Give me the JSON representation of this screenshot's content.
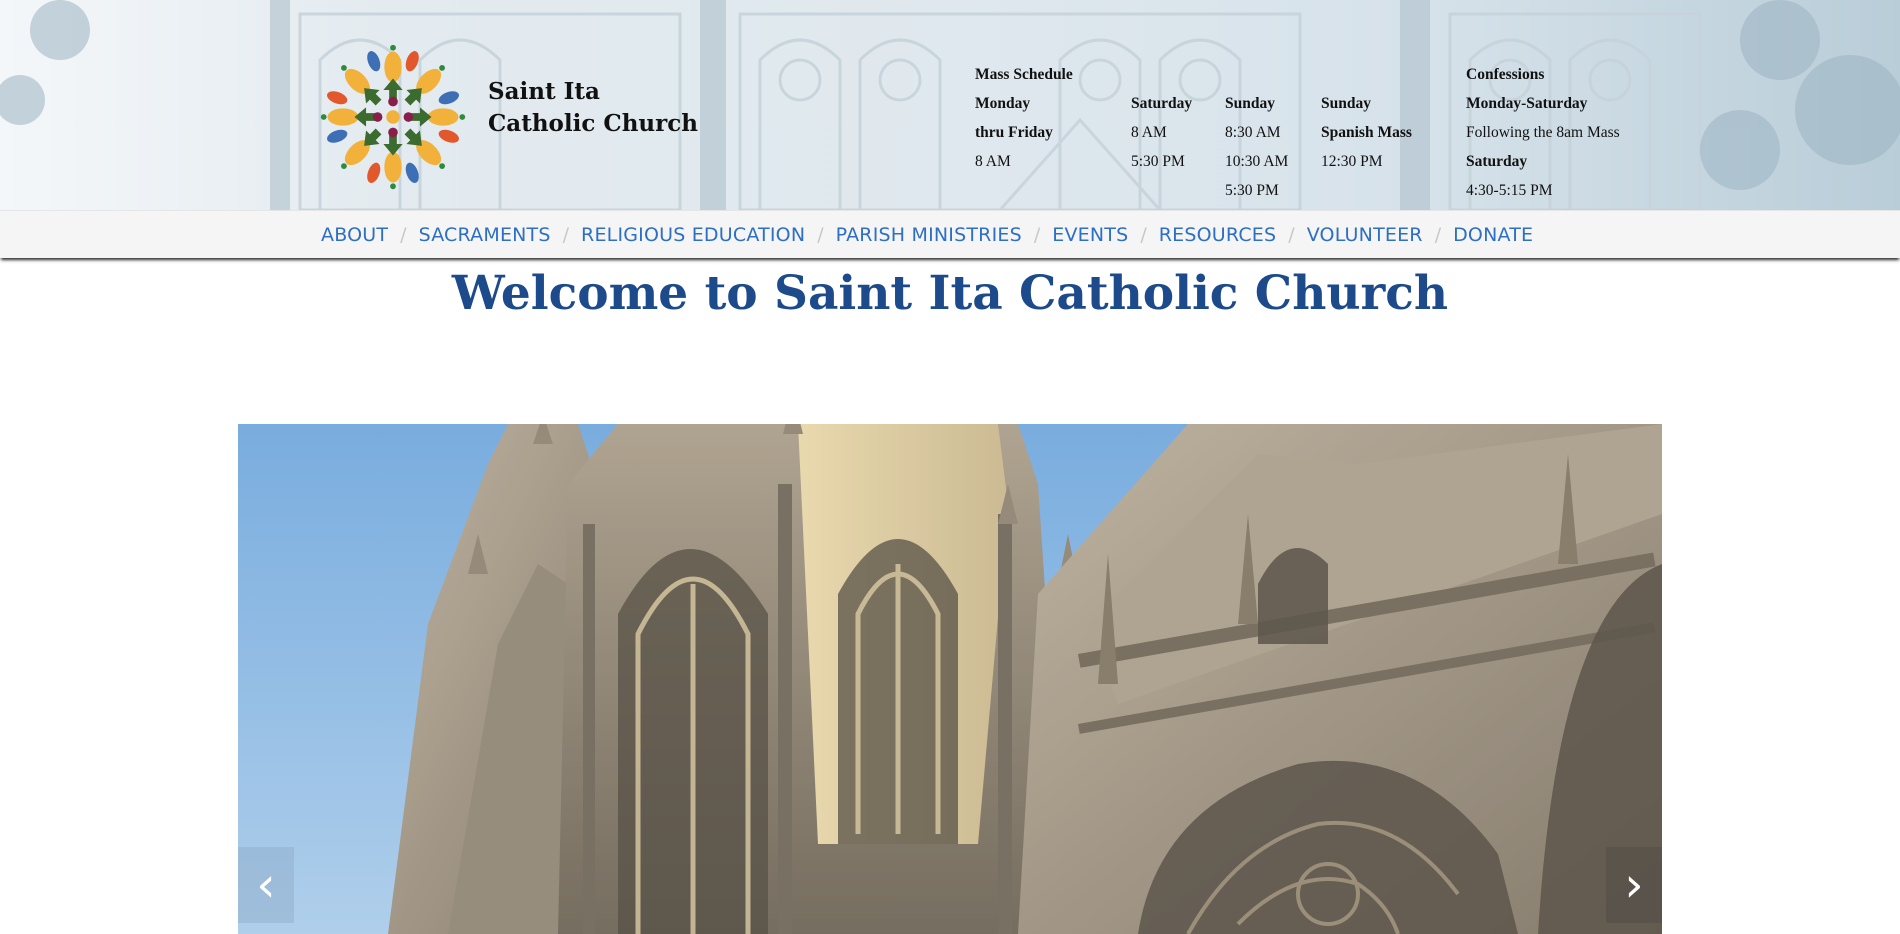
{
  "site": {
    "name_line1": "Saint Ita",
    "name_line2": "Catholic Church"
  },
  "mass_schedule": {
    "heading": "Mass Schedule",
    "weekday": {
      "line1": "Monday",
      "line2": "thru Friday",
      "time": "8 AM"
    },
    "saturday": {
      "day": "Saturday",
      "time1": "8 AM",
      "time2": "5:30 PM"
    },
    "sunday": {
      "day": "Sunday",
      "time1": "8:30 AM",
      "time2": "10:30 AM",
      "time3": "5:30 PM"
    },
    "sunday_spanish": {
      "day": "Sunday",
      "label": "Spanish Mass",
      "time": "12:30 PM"
    }
  },
  "confessions": {
    "heading": "Confessions",
    "days": "Monday-Saturday",
    "note": "Following the 8am Mass",
    "saturday": "Saturday",
    "saturday_time": "4:30-5:15 PM"
  },
  "nav": {
    "items": [
      {
        "label": "ABOUT"
      },
      {
        "label": "SACRAMENTS"
      },
      {
        "label": "RELIGIOUS EDUCATION"
      },
      {
        "label": "PARISH MINISTRIES"
      },
      {
        "label": "EVENTS"
      },
      {
        "label": "RESOURCES"
      },
      {
        "label": "VOLUNTEER"
      },
      {
        "label": "DONATE"
      }
    ],
    "separator": "/"
  },
  "welcome": {
    "title": "Welcome to Saint Ita Catholic Church"
  },
  "slider": {
    "prev_label": "‹",
    "next_label": "›",
    "image_subject": "gothic church facade against blue sky"
  },
  "colors": {
    "nav_link": "#2d6fc4",
    "title": "#1c4a8a",
    "nav_bg": "#f5f5f5"
  }
}
